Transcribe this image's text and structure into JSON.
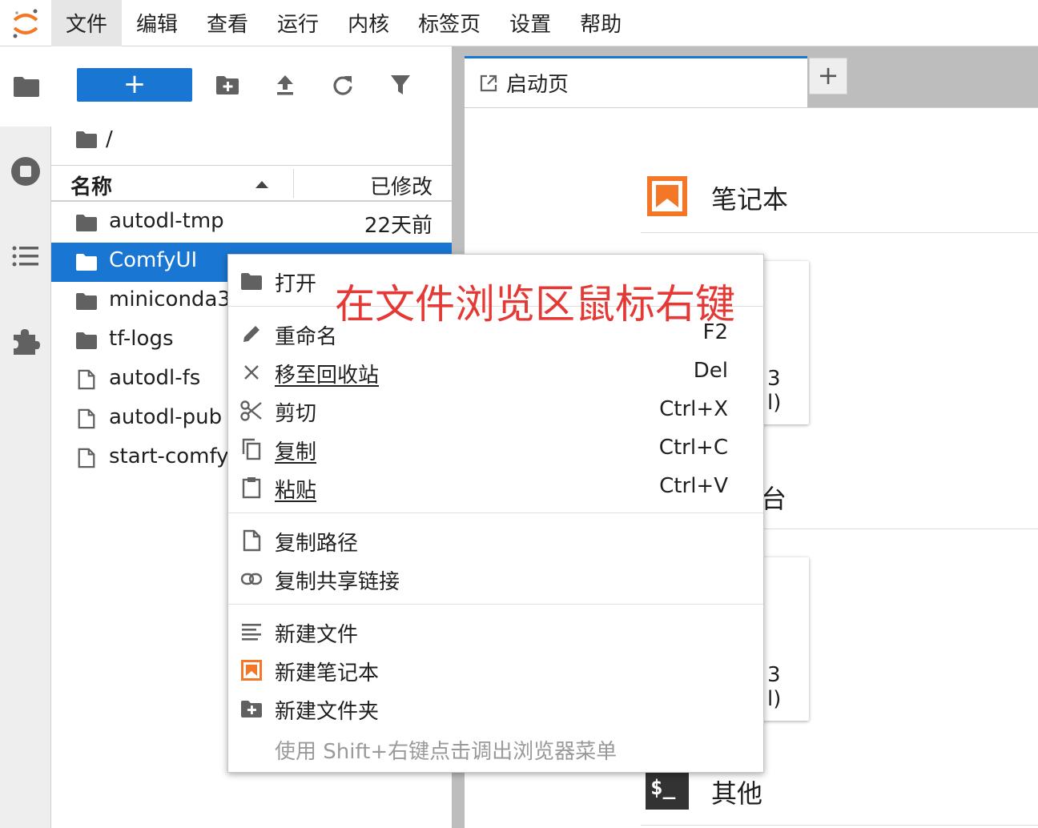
{
  "menubar": {
    "items": [
      "文件",
      "编辑",
      "查看",
      "运行",
      "内核",
      "标签页",
      "设置",
      "帮助"
    ],
    "active_index": 0
  },
  "colors": {
    "accent": "#1976d2",
    "notebook_orange": "#f37726",
    "annotation_red": "#e53935"
  },
  "filebrowser": {
    "new_label": "+",
    "breadcrumb": "/",
    "column_name": "名称",
    "column_modified": "已修改",
    "rows": [
      {
        "name": "autodl-tmp",
        "type": "folder",
        "modified": "22天前"
      },
      {
        "name": "ComfyUI",
        "type": "folder",
        "modified": "",
        "selected": true
      },
      {
        "name": "miniconda3",
        "type": "folder",
        "modified": ""
      },
      {
        "name": "tf-logs",
        "type": "folder",
        "modified": ""
      },
      {
        "name": "autodl-fs",
        "type": "file",
        "modified": ""
      },
      {
        "name": "autodl-pub",
        "type": "file",
        "modified": ""
      },
      {
        "name": "start-comfyu",
        "type": "file",
        "modified": ""
      }
    ]
  },
  "main": {
    "tab_title": "启动页",
    "tab_add": "+",
    "sections": {
      "notebook": "笔记本",
      "console_partial": "台",
      "other": "其他",
      "terminal_icon": "$_"
    },
    "card_partials": [
      "3",
      "l)",
      "3",
      "l)"
    ]
  },
  "context_menu": {
    "items": [
      {
        "label": "打开",
        "shortcut": "",
        "icon": "folder-icon"
      },
      {
        "label": "重命名",
        "shortcut": "F2",
        "icon": "pencil-icon"
      },
      {
        "label": "移至回收站",
        "shortcut": "Del",
        "icon": "close-icon"
      },
      {
        "label": "剪切",
        "shortcut": "Ctrl+X",
        "icon": "scissors-icon"
      },
      {
        "label": "复制",
        "shortcut": "Ctrl+C",
        "icon": "copy-icon"
      },
      {
        "label": "粘贴",
        "shortcut": "Ctrl+V",
        "icon": "paste-icon"
      },
      {
        "label": "复制路径",
        "shortcut": "",
        "icon": "file-icon"
      },
      {
        "label": "复制共享链接",
        "shortcut": "",
        "icon": "link-icon"
      },
      {
        "label": "新建文件",
        "shortcut": "",
        "icon": "text-file-icon"
      },
      {
        "label": "新建笔记本",
        "shortcut": "",
        "icon": "notebook-icon"
      },
      {
        "label": "新建文件夹",
        "shortcut": "",
        "icon": "new-folder-icon"
      }
    ],
    "hint": "使用 Shift+右键点击调出浏览器菜单"
  },
  "annotation": "在文件浏览区鼠标右键"
}
